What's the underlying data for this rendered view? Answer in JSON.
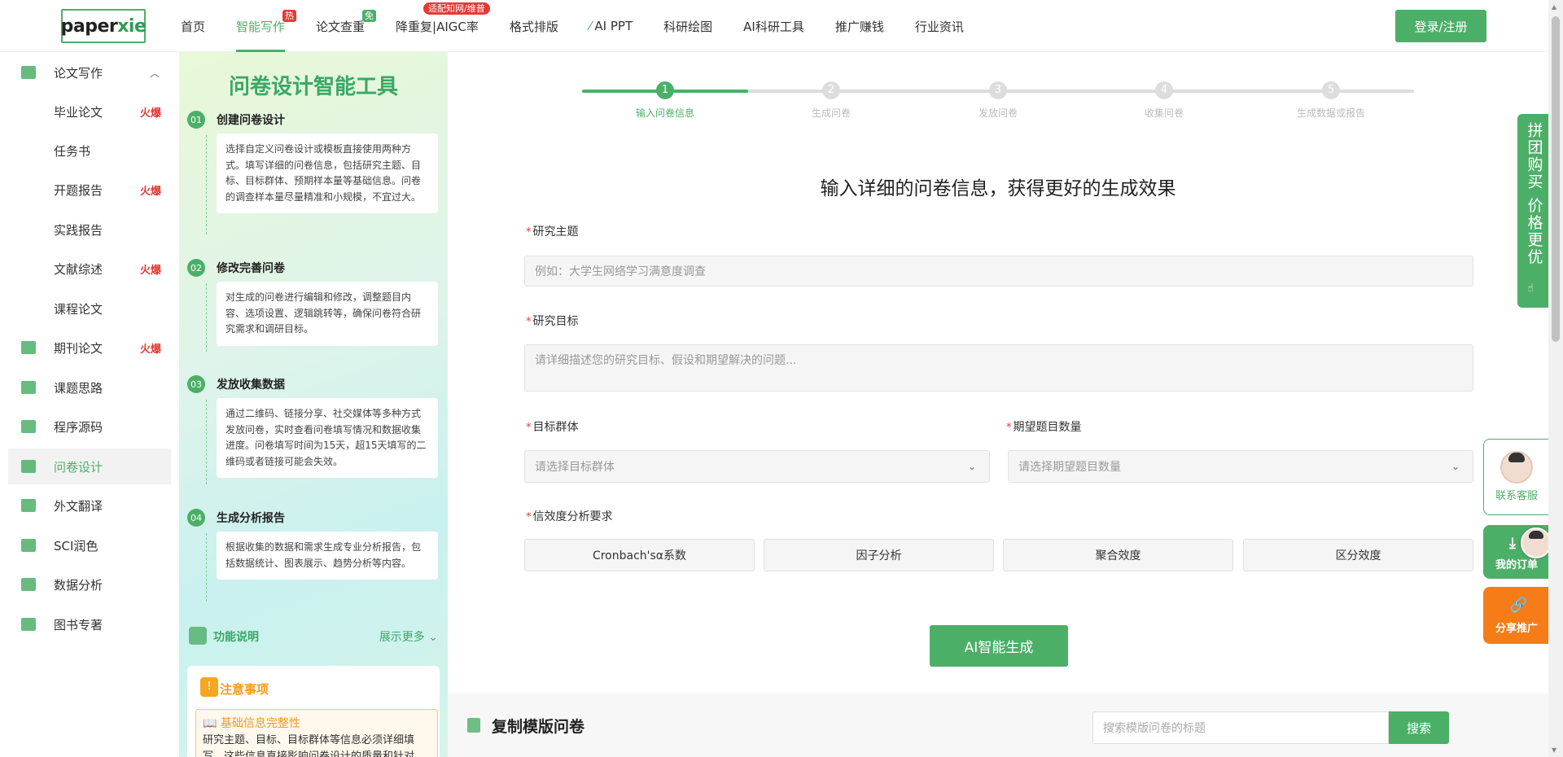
{
  "header": {
    "logo_main": "paper",
    "logo_accent": "xie",
    "nav": [
      {
        "label": "首页"
      },
      {
        "label": "智能写作",
        "badge": "热"
      },
      {
        "label": "论文查重",
        "badge": "免"
      },
      {
        "label": "降重复|AIGC率",
        "badge": "适配知网/维普"
      },
      {
        "label": "格式排版"
      },
      {
        "label": "AI PPT"
      },
      {
        "label": "科研绘图"
      },
      {
        "label": "AI科研工具"
      },
      {
        "label": "推广赚钱"
      },
      {
        "label": "行业资讯"
      }
    ],
    "login_label": "登录/注册"
  },
  "sidebar": {
    "items": [
      {
        "label": "论文写作",
        "icon": "pen-icon"
      },
      {
        "label": "毕业论文",
        "hot": "火爆"
      },
      {
        "label": "任务书"
      },
      {
        "label": "开题报告",
        "hot": "火爆"
      },
      {
        "label": "实践报告"
      },
      {
        "label": "文献综述",
        "hot": "火爆"
      },
      {
        "label": "课程论文"
      },
      {
        "label": "期刊论文",
        "hot": "火爆",
        "icon": "journal-icon"
      },
      {
        "label": "课题思路",
        "icon": "idea-icon"
      },
      {
        "label": "程序源码",
        "icon": "code-icon"
      },
      {
        "label": "问卷设计",
        "icon": "survey-icon"
      },
      {
        "label": "外文翻译",
        "icon": "translate-icon"
      },
      {
        "label": "SCI润色",
        "icon": "sci-icon"
      },
      {
        "label": "数据分析",
        "icon": "chart-icon"
      },
      {
        "label": "图书专著",
        "icon": "book-icon"
      }
    ]
  },
  "guide": {
    "title": "问卷设计智能工具",
    "steps": [
      {
        "num": "01",
        "title": "创建问卷设计",
        "text": "选择自定义问卷设计或模板直接使用两种方式。填写详细的问卷信息，包括研究主题、目标、目标群体、预期样本量等基础信息。问卷的调查样本量尽量精准和小规模，不宜过大。"
      },
      {
        "num": "02",
        "title": "修改完善问卷",
        "text": "对生成的问卷进行编辑和修改，调整题目内容、选项设置、逻辑跳转等，确保问卷符合研究需求和调研目标。"
      },
      {
        "num": "03",
        "title": "发放收集数据",
        "text": "通过二维码、链接分享、社交媒体等多种方式发放问卷，实时查看问卷填写情况和数据收集进度。问卷填写时间为15天，超15天填写的二维码或者链接可能会失效。"
      },
      {
        "num": "04",
        "title": "生成分析报告",
        "text": "根据收集的数据和需求生成专业分析报告，包括数据统计、图表展示、趋势分析等内容。"
      }
    ],
    "func_label": "功能说明",
    "more_label": "展示更多",
    "notice_title": "注意事项",
    "notice_sub": "基础信息完整性",
    "notice_text": "研究主题、目标、目标群体等信息必须详细填写，这些信息直接影响问卷设计的质量和针对"
  },
  "progress": {
    "steps": [
      "输入问卷信息",
      "生成问卷",
      "发放问卷",
      "收集问卷",
      "生成数据或报告"
    ],
    "current": 1
  },
  "form": {
    "heading": "输入详细的问卷信息，获得更好的生成效果",
    "topic_label": "研究主题",
    "topic_placeholder": "例如：大学生网络学习满意度调查",
    "goal_label": "研究目标",
    "goal_placeholder": "请详细描述您的研究目标、假设和期望解决的问题...",
    "group_label": "目标群体",
    "group_placeholder": "请选择目标群体",
    "count_label": "期望题目数量",
    "count_placeholder": "请选择期望题目数量",
    "validity_label": "信效度分析要求",
    "validity_options": [
      "Cronbach'sα系数",
      "因子分析",
      "聚合效度",
      "区分效度"
    ],
    "generate_label": "AI智能生成"
  },
  "templates": {
    "title": "复制模版问卷",
    "search_placeholder": "搜索模版问卷的标题",
    "search_button": "搜索"
  },
  "floating": {
    "groupbuy": "拼团购买 价格更优",
    "service": "联系客服",
    "orders": "我的订单",
    "share": "分享推广"
  },
  "colors": {
    "accent": "#4caf68",
    "hot": "#e53935",
    "share": "#f57c16"
  }
}
